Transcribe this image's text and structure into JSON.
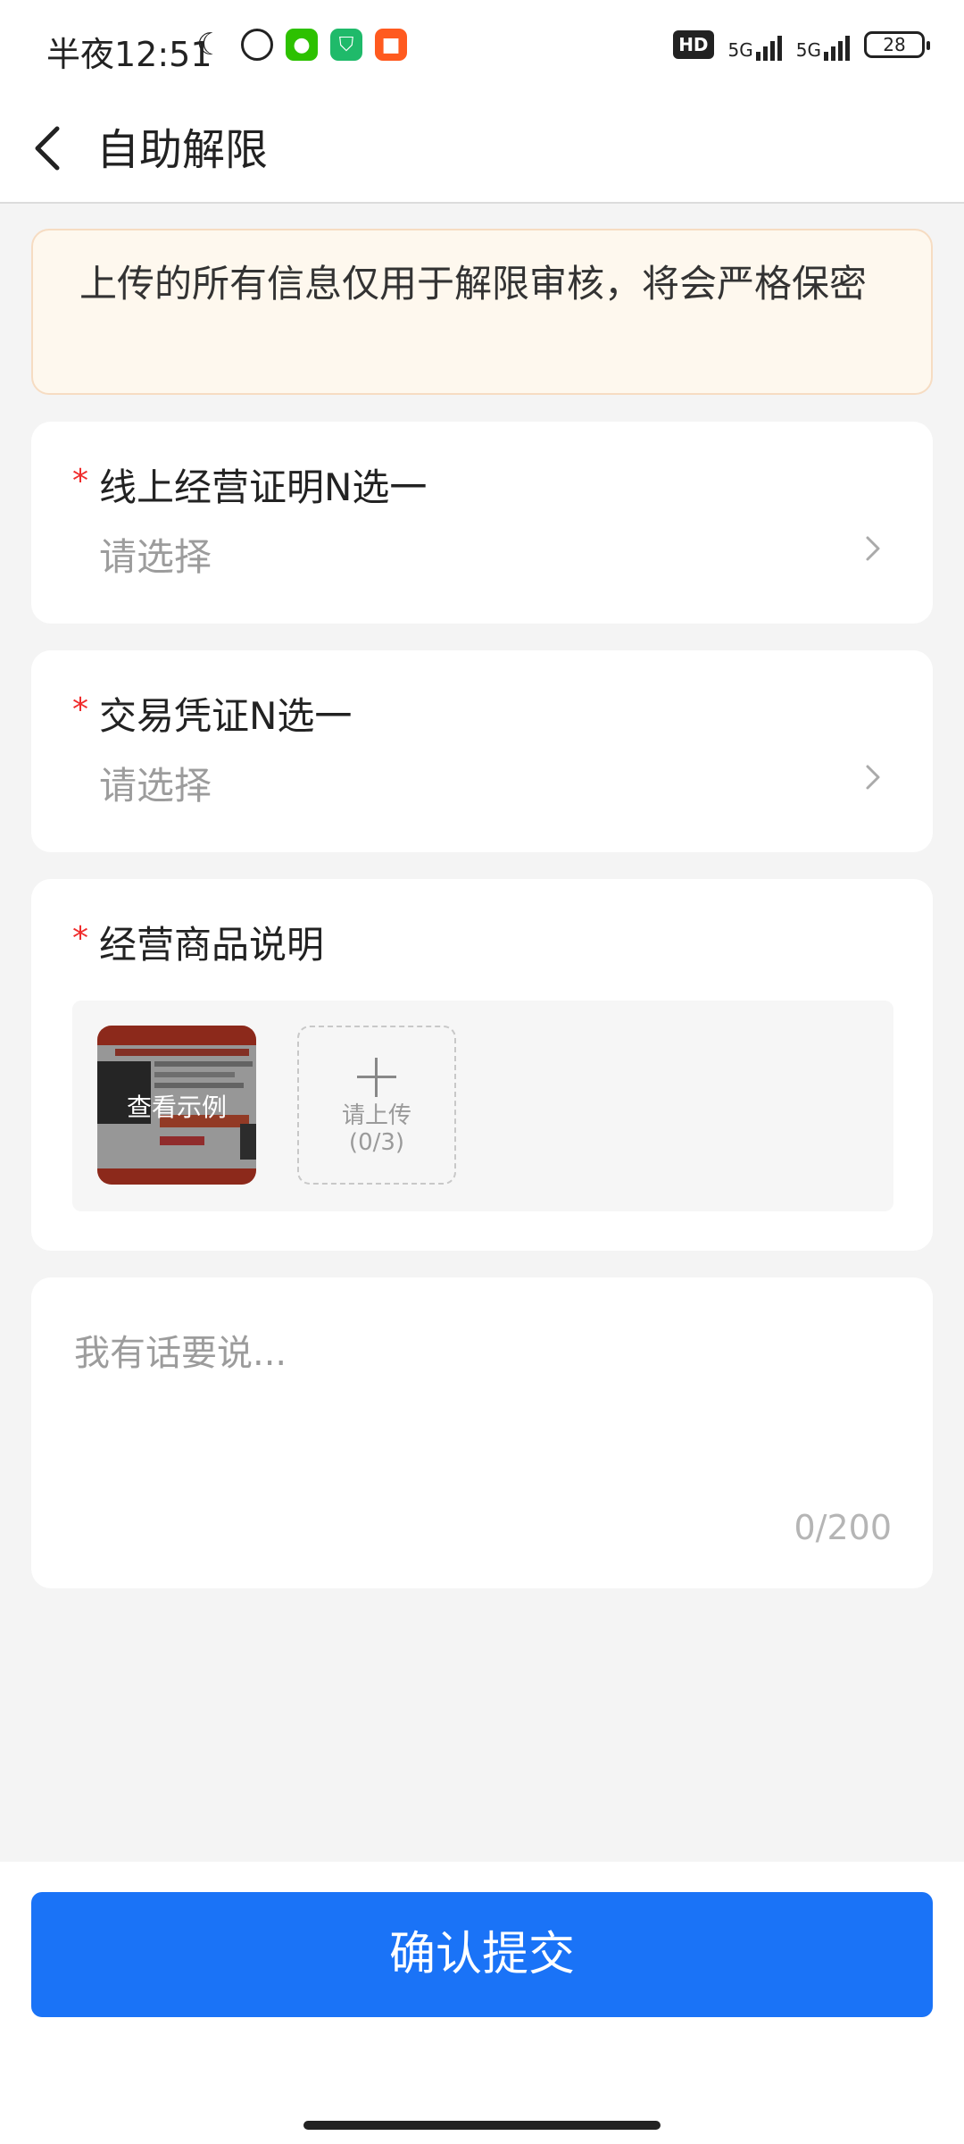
{
  "status_bar": {
    "time": "半夜12:51",
    "network_label_1": "5G",
    "network_label_2": "5G",
    "hd_label": "HD",
    "battery": "28"
  },
  "header": {
    "title": "自助解限"
  },
  "notice": {
    "text": "上传的所有信息仅用于解限审核，将会严格保密"
  },
  "fields": [
    {
      "required_mark": "*",
      "label": "线上经营证明N选一",
      "placeholder": "请选择"
    },
    {
      "required_mark": "*",
      "label": "交易凭证N选一",
      "placeholder": "请选择"
    }
  ],
  "product_desc": {
    "required_mark": "*",
    "label": "经营商品说明",
    "sample_label": "查看示例",
    "upload_label_line1": "请上传",
    "upload_label_line2": "(0/3)"
  },
  "comment": {
    "placeholder": "我有话要说...",
    "counter": "0/200"
  },
  "submit_label": "确认提交",
  "colors": {
    "accent": "#1a73f7",
    "required": "#f02c2c",
    "notice_bg": "#fef8ee"
  }
}
